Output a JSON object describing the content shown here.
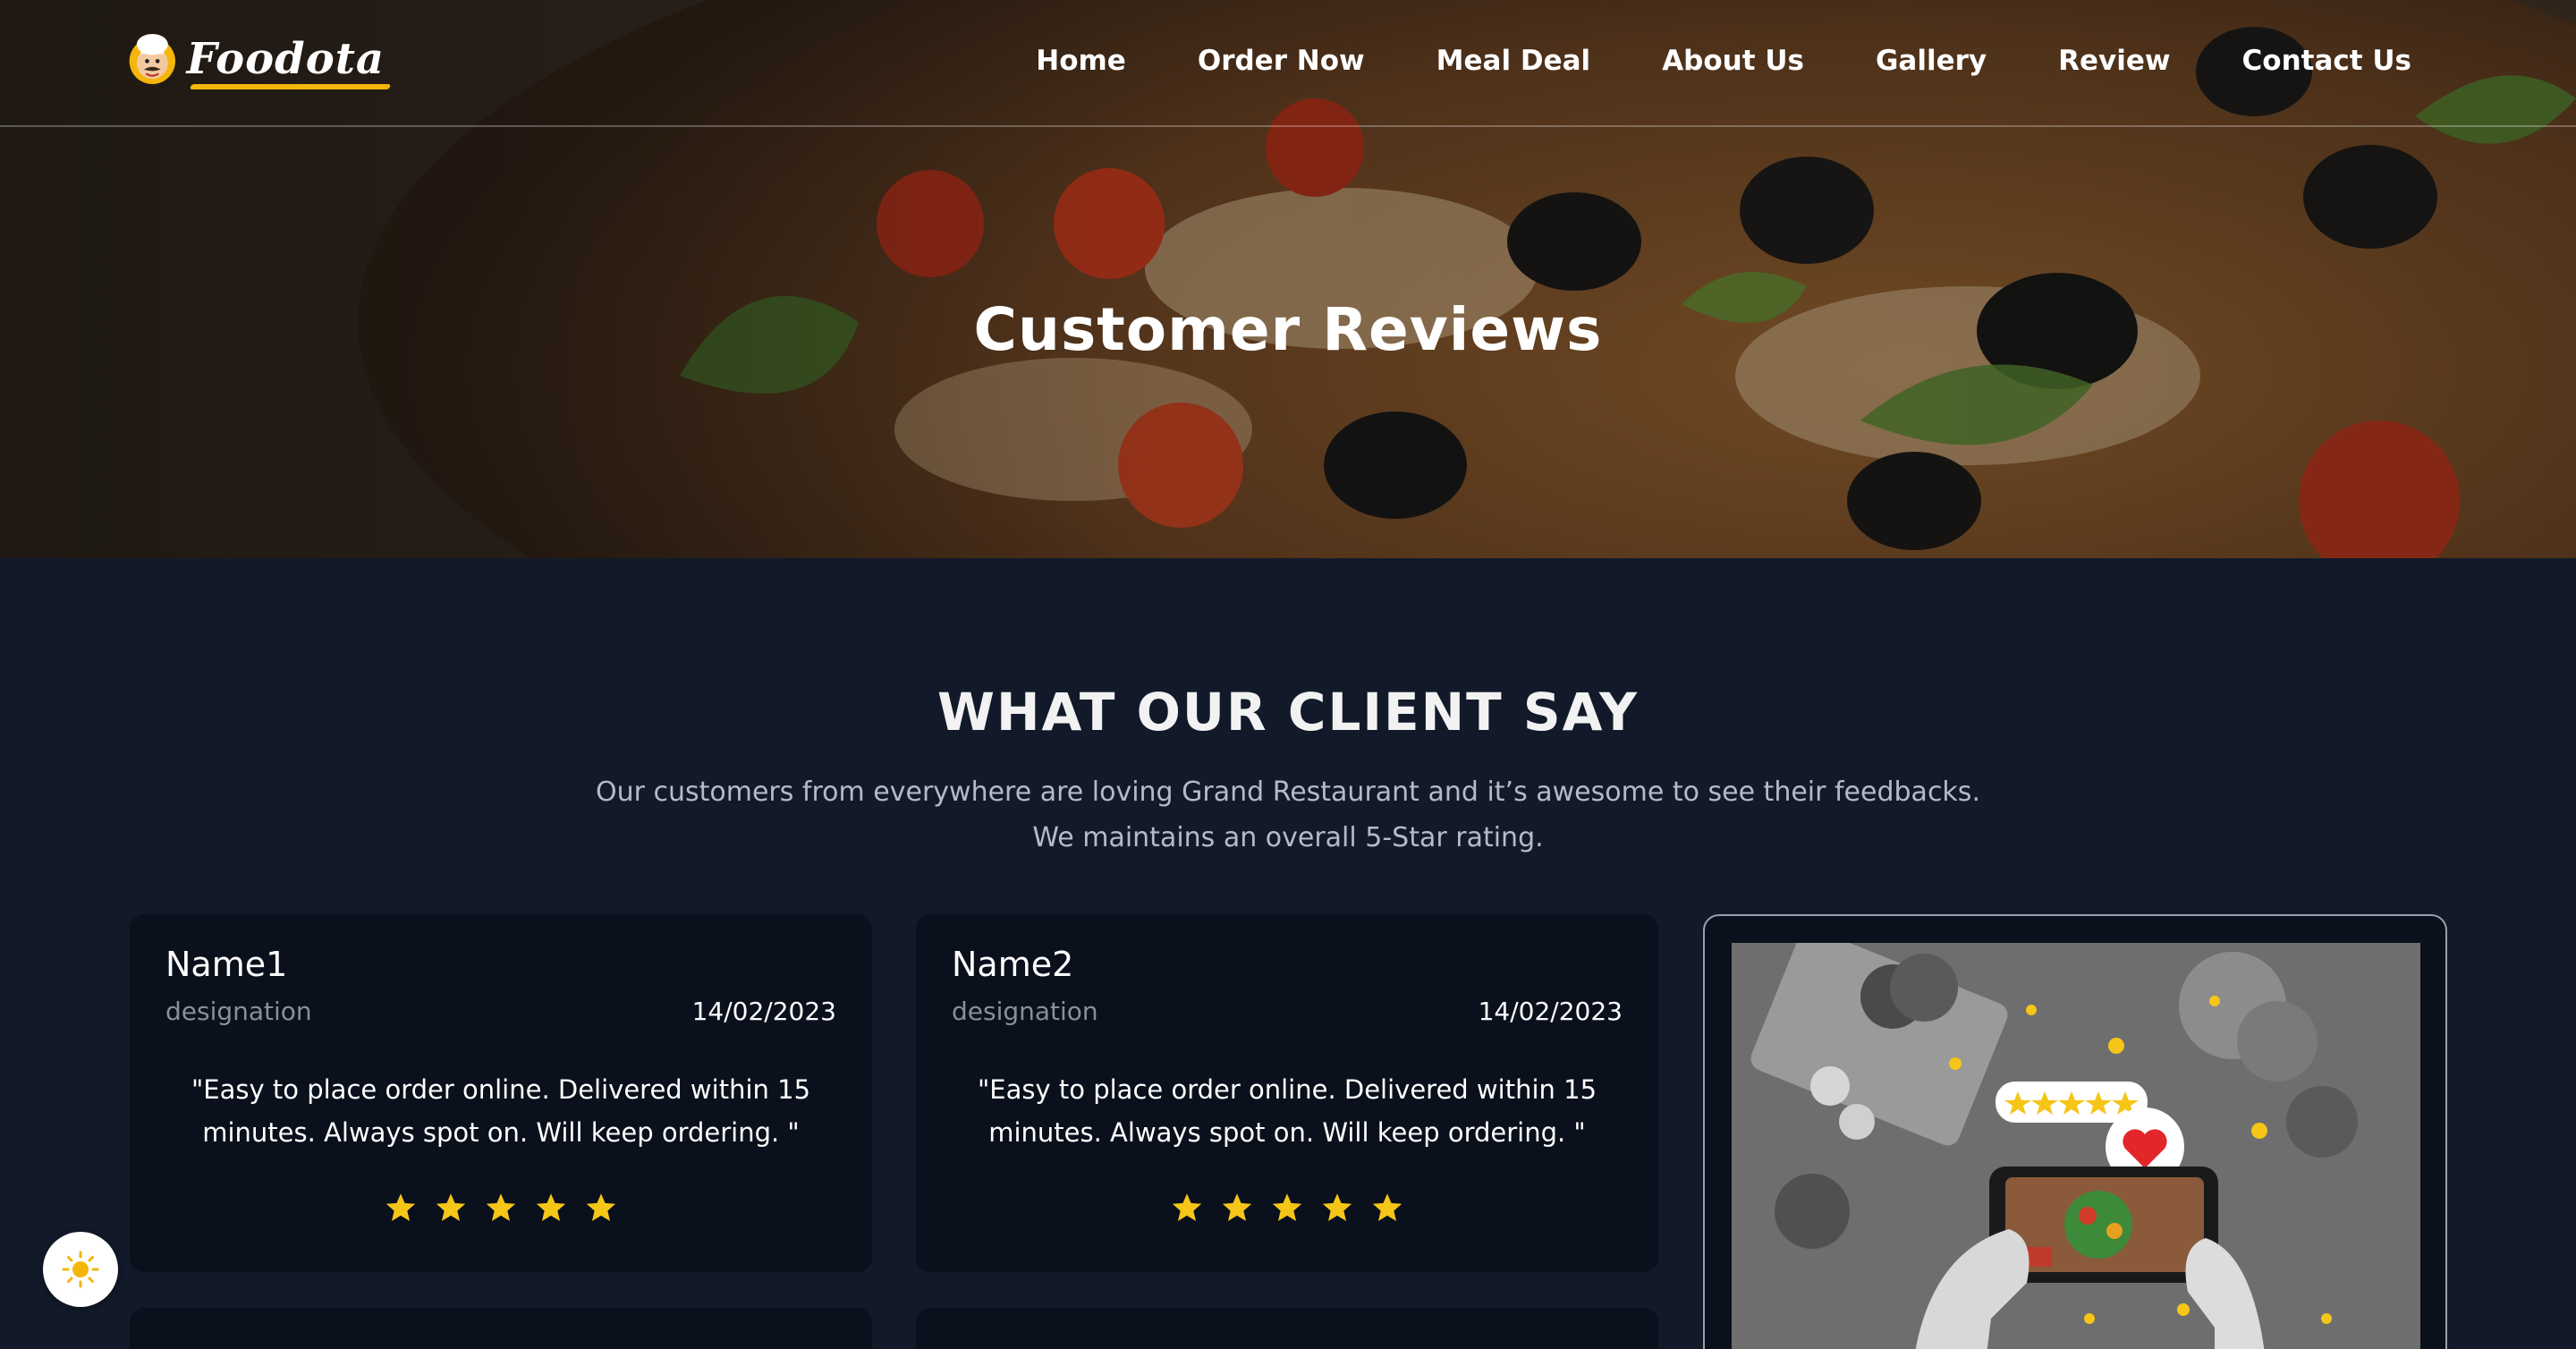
{
  "brand": {
    "name": "Foodota"
  },
  "nav": {
    "items": [
      "Home",
      "Order Now",
      "Meal Deal",
      "About Us",
      "Gallery",
      "Review",
      "Contact Us"
    ]
  },
  "hero": {
    "title": "Customer Reviews"
  },
  "section": {
    "title": "WHAT OUR CLIENT SAY",
    "subtitle_line1": "Our customers from everywhere are loving Grand Restaurant and it’s awesome to see their feedbacks.",
    "subtitle_line2": "We maintains an overall 5-Star rating."
  },
  "reviews": [
    {
      "name": "Name1",
      "designation": "designation",
      "date": "14/02/2023",
      "quote": "\"Easy to place order online. Delivered within 15 minutes. Always spot on. Will keep ordering. \"",
      "rating": 5
    },
    {
      "name": "Name2",
      "designation": "designation",
      "date": "14/02/2023",
      "quote": "\"Easy to place order online. Delivered within 15 minutes. Always spot on. Will keep ordering. \"",
      "rating": 5
    }
  ],
  "colors": {
    "accent": "#f5b50a",
    "background": "#121a2a",
    "card": "#0a101c",
    "star": "#f5c518"
  },
  "icons": {
    "theme_toggle": "sun-icon",
    "rating": "star-icon"
  }
}
